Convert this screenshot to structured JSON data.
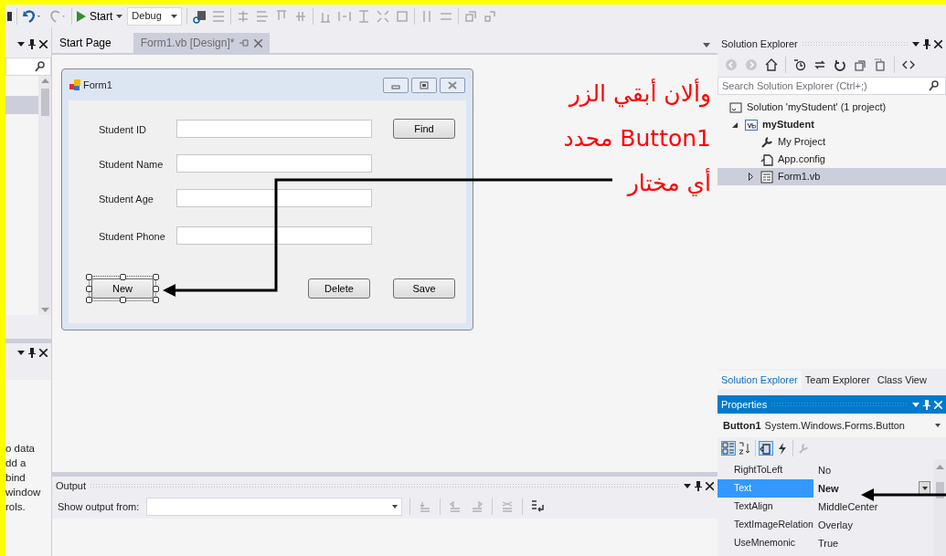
{
  "toolbar": {
    "start_label": "Start",
    "configuration": "Debug"
  },
  "left_panel": {
    "help_lines": [
      "o data",
      "dd a",
      "bind",
      "window",
      "rols."
    ]
  },
  "document_tabs": [
    {
      "label": "Start Page",
      "selected": false
    },
    {
      "label": "Form1.vb [Design]*",
      "selected": true
    }
  ],
  "form": {
    "title": "Form1",
    "fields": [
      {
        "label": "Student ID"
      },
      {
        "label": "Student Name"
      },
      {
        "label": "Student Age"
      },
      {
        "label": "Student Phone"
      }
    ],
    "buttons": [
      {
        "label": "Find",
        "selected": false
      },
      {
        "label": "New",
        "selected": true
      },
      {
        "label": "Delete",
        "selected": false
      },
      {
        "label": "Save",
        "selected": false
      }
    ]
  },
  "annotation": {
    "lines": [
      "وألان أبقي الزر",
      "Button1 محدد",
      "أي مختار"
    ]
  },
  "output": {
    "title": "Output",
    "source_label": "Show output from:"
  },
  "solution_explorer": {
    "title": "Solution Explorer",
    "search_placeholder": "Search Solution Explorer (Ctrl+;)",
    "tree": [
      {
        "label": "Solution 'myStudent' (1 project)",
        "kind": "solution",
        "selected": false,
        "children": [
          {
            "label": "myStudent",
            "kind": "project",
            "expanded": true,
            "selected": false,
            "children": [
              {
                "label": "My Project",
                "kind": "properties",
                "selected": false
              },
              {
                "label": "App.config",
                "kind": "config",
                "selected": false
              },
              {
                "label": "Form1.vb",
                "kind": "form",
                "expanded": false,
                "selected": true
              }
            ]
          }
        ]
      }
    ]
  },
  "side_tabs": [
    {
      "label": "Solution Explorer",
      "selected": true
    },
    {
      "label": "Team Explorer",
      "selected": false
    },
    {
      "label": "Class View",
      "selected": false
    }
  ],
  "properties": {
    "title": "Properties",
    "object_name": "Button1",
    "object_type": "System.Windows.Forms.Button",
    "rows": [
      {
        "name": "RightToLeft",
        "value": "No",
        "selected": false,
        "modified": false
      },
      {
        "name": "Text",
        "value": "New",
        "selected": true,
        "modified": true
      },
      {
        "name": "TextAlign",
        "value": "MiddleCenter",
        "selected": false,
        "modified": false
      },
      {
        "name": "TextImageRelation",
        "value": "Overlay",
        "selected": false,
        "modified": false
      },
      {
        "name": "UseMnemonic",
        "value": "True",
        "selected": false,
        "modified": false
      }
    ]
  }
}
